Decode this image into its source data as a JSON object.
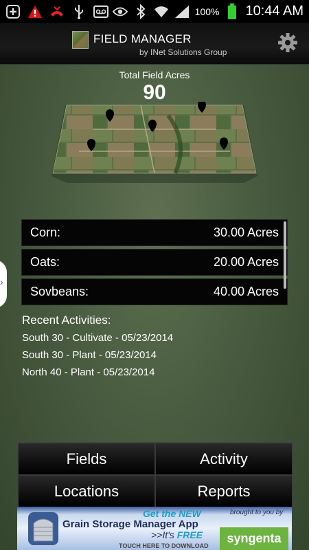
{
  "status_bar": {
    "icons_left": [
      "add-icon",
      "warning-icon",
      "missed-call-icon",
      "usb-icon",
      "voicemail-icon"
    ],
    "icons_right": [
      "eye-icon",
      "bluetooth-icon",
      "wifi-icon",
      "signal-icon",
      "battery-icon"
    ],
    "battery": "100%",
    "time": "10:44 AM"
  },
  "header": {
    "title": "FIELD MANAGER",
    "subtitle": "by INet Solutions Group"
  },
  "summary": {
    "total_label": "Total Field Acres",
    "total_value": "90"
  },
  "crops": [
    {
      "name": "Corn:",
      "acres": "30.00 Acres"
    },
    {
      "name": "Oats:",
      "acres": "20.00 Acres"
    },
    {
      "name": "Sovbeans:",
      "acres": "40.00 Acres"
    }
  ],
  "side_tab": {
    "glyph": "›"
  },
  "activities": {
    "heading": "Recent Activities:",
    "items": [
      "South 30 - Cultivate - 05/23/2014",
      "South 30 - Plant - 05/23/2014",
      "North 40 - Plant - 05/23/2014"
    ]
  },
  "nav": {
    "fields": "Fields",
    "activity": "Activity",
    "locations": "Locations",
    "reports": "Reports"
  },
  "ad": {
    "line1": "Get the NEW",
    "line2": "Grain Storage Manager App",
    "line3_prefix": ">>It's ",
    "line3_emph": "FREE",
    "line4": "TOUCH HERE TO DOWNLOAD",
    "brought": "brought to you by",
    "brand": "syngenta",
    "accent": "#1aa0c8",
    "brand_color": "#6db33f"
  }
}
